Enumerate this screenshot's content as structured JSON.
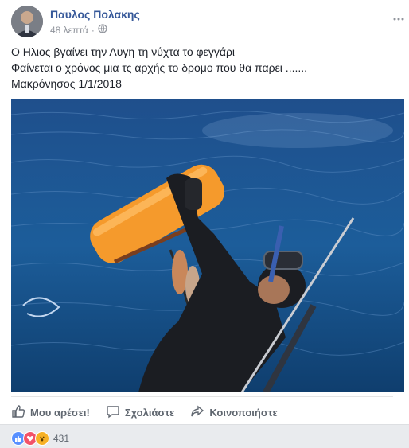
{
  "post": {
    "author": "Παυλος Πολακης",
    "timestamp": "48 λεπτά",
    "privacy_icon": "globe-icon",
    "more_icon": "more-options-icon",
    "lines": [
      "Ο Ηλιος βγαίνει την Αυγη τη νύχτα το φεγγάρι",
      "Φαίνεται ο χρόνος μια τς αρχής το δρομο που θα παρει .......",
      "Μακρόνησος 1/1/2018"
    ]
  },
  "actions": {
    "like_label": "Μου αρέσει!",
    "comment_label": "Σχολιάστε",
    "share_label": "Κοινοποιήστε"
  },
  "reactions": {
    "types": [
      "like-icon",
      "love-icon",
      "wow-icon"
    ],
    "colors": {
      "like": "#5890ff",
      "love": "#f25268",
      "wow": "#f7b125"
    },
    "count": "431"
  },
  "colors": {
    "author": "#365899",
    "meta": "#90949c",
    "text": "#1d2129",
    "action": "#606770"
  }
}
